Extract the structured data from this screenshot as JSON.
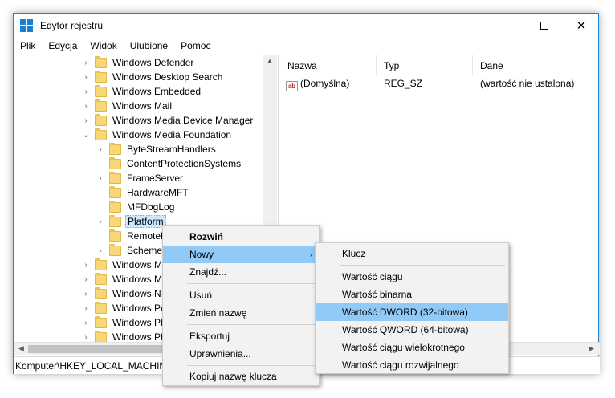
{
  "window": {
    "title": "Edytor rejestru"
  },
  "menubar": [
    "Plik",
    "Edycja",
    "Widok",
    "Ulubione",
    "Pomoc"
  ],
  "tree": [
    {
      "label": "Windows Defender",
      "chev": "›"
    },
    {
      "label": "Windows Desktop Search",
      "chev": "›"
    },
    {
      "label": "Windows Embedded",
      "chev": "›"
    },
    {
      "label": "Windows Mail",
      "chev": "›"
    },
    {
      "label": "Windows Media Device Manager",
      "chev": "›"
    },
    {
      "label": "Windows Media Foundation",
      "chev": "⌄"
    },
    {
      "label": "ByteStreamHandlers",
      "chev": "›"
    },
    {
      "label": "ContentProtectionSystems",
      "chev": ""
    },
    {
      "label": "FrameServer",
      "chev": "›"
    },
    {
      "label": "HardwareMFT",
      "chev": ""
    },
    {
      "label": "MFDbgLog",
      "chev": ""
    },
    {
      "label": "Platform",
      "chev": "›"
    },
    {
      "label": "RemoteD",
      "chev": ""
    },
    {
      "label": "SchemeH",
      "chev": "›"
    },
    {
      "label": "Windows M",
      "chev": "›"
    },
    {
      "label": "Windows M",
      "chev": "›"
    },
    {
      "label": "Windows N",
      "chev": "›"
    },
    {
      "label": "Windows Pe",
      "chev": "›"
    },
    {
      "label": "Windows Ph",
      "chev": "›"
    },
    {
      "label": "Windows Ph",
      "chev": "›"
    }
  ],
  "list": {
    "headers": {
      "name": "Nazwa",
      "type": "Typ",
      "data": "Dane"
    },
    "rows": [
      {
        "name": "(Domyślna)",
        "type": "REG_SZ",
        "data": "(wartość nie ustalona)",
        "icon": "ab-string-icon"
      }
    ]
  },
  "status": "Komputer\\HKEY_LOCAL_MACHIN",
  "context_menu": {
    "items": [
      "Rozwiń",
      "Nowy",
      "Znajdź...",
      "Usuń",
      "Zmień nazwę",
      "Eksportuj",
      "Uprawnienia...",
      "Kopiuj nazwę klucza"
    ]
  },
  "submenu": {
    "items": [
      "Klucz",
      "Wartość ciągu",
      "Wartość binarna",
      "Wartość DWORD (32-bitowa)",
      "Wartość QWORD (64-bitowa)",
      "Wartość ciągu wielokrotnego",
      "Wartość ciągu rozwijalnego"
    ]
  },
  "colors": {
    "accent": "#1883d7",
    "selection": "#cce8ff",
    "menu_highlight": "#91c9f7",
    "folder": "#f7d778"
  }
}
